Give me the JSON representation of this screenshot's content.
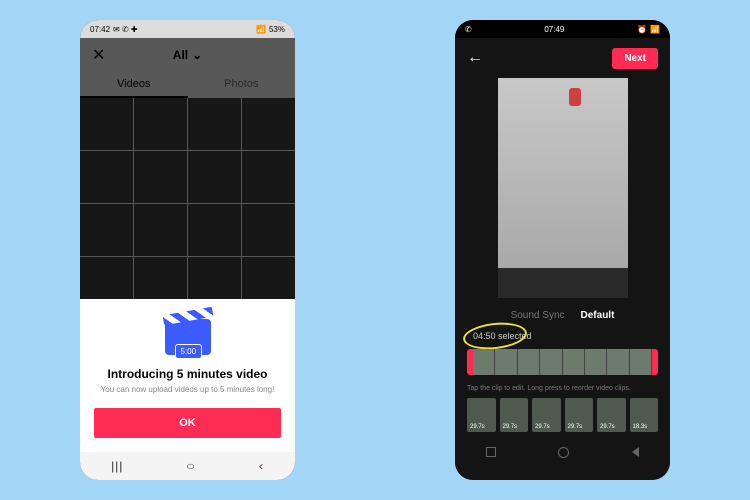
{
  "phoneA": {
    "status": {
      "time": "07:42",
      "battery": "53%"
    },
    "header": {
      "close": "✕",
      "dropdown": "All",
      "chevron": "⌄"
    },
    "tabs": {
      "videos": "Videos",
      "photos": "Photos"
    },
    "sheet": {
      "badge": "5:00",
      "title": "Introducing 5 minutes video",
      "subtitle": "You can now upload videos up to 5 minutes long!",
      "ok": "OK"
    },
    "nav": {
      "recent": "|||",
      "home": "○",
      "back": "‹"
    }
  },
  "phoneB": {
    "status": {
      "time": "07:49"
    },
    "top": {
      "back": "←",
      "next": "Next"
    },
    "modes": {
      "soundSync": "Sound Sync",
      "default": "Default"
    },
    "selected": "04:50 selected",
    "hint": "Tap the clip to edit. Long press to reorder video clips.",
    "thumbs": [
      "29.7s",
      "29.7s",
      "29.7s",
      "29.7s",
      "29.7s",
      "18.3s"
    ]
  }
}
